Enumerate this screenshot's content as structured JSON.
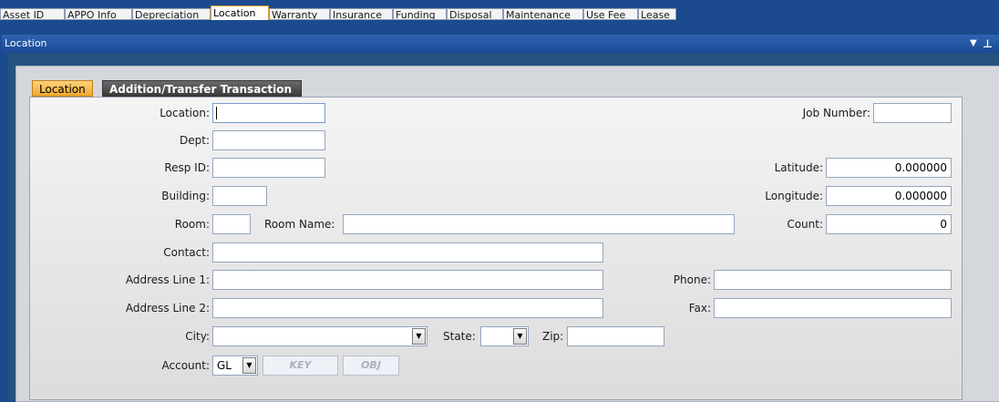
{
  "top_tabs": [
    {
      "label": "Asset ID"
    },
    {
      "label": "APPO Info"
    },
    {
      "label": "Depreciation"
    },
    {
      "label": "Location",
      "active": true
    },
    {
      "label": "Warranty"
    },
    {
      "label": "Insurance"
    },
    {
      "label": "Funding"
    },
    {
      "label": "Disposal"
    },
    {
      "label": "Maintenance"
    },
    {
      "label": "Use Fee"
    },
    {
      "label": "Lease"
    }
  ],
  "panel": {
    "title": "Location",
    "menu_icon": "dropdown-arrow-icon",
    "pin_icon": "pin-icon"
  },
  "inner_tabs": [
    {
      "label": "Location",
      "active": true
    },
    {
      "label": "Addition/Transfer Transaction"
    }
  ],
  "form": {
    "location": {
      "label": "Location:",
      "value": ""
    },
    "dept": {
      "label": "Dept:",
      "value": ""
    },
    "resp_id": {
      "label": "Resp ID:",
      "value": ""
    },
    "building": {
      "label": "Building:",
      "value": ""
    },
    "room": {
      "label": "Room:",
      "value": ""
    },
    "room_name": {
      "label": "Room Name:",
      "value": ""
    },
    "contact": {
      "label": "Contact:",
      "value": ""
    },
    "address1": {
      "label": "Address Line 1:",
      "value": ""
    },
    "address2": {
      "label": "Address Line 2:",
      "value": ""
    },
    "city": {
      "label": "City:",
      "value": ""
    },
    "state": {
      "label": "State:",
      "value": ""
    },
    "zip": {
      "label": "Zip:",
      "value": ""
    },
    "account": {
      "label": "Account:",
      "value": "GL",
      "key_placeholder": "KEY",
      "obj_placeholder": "OBJ"
    },
    "job_number": {
      "label": "Job Number:",
      "value": ""
    },
    "latitude": {
      "label": "Latitude:",
      "value": "0.000000"
    },
    "longitude": {
      "label": "Longitude:",
      "value": "0.000000"
    },
    "count": {
      "label": "Count:",
      "value": "0"
    },
    "phone": {
      "label": "Phone:",
      "value": ""
    },
    "fax": {
      "label": "Fax:",
      "value": ""
    }
  },
  "colors": {
    "header_blue": "#1b4a8e",
    "active_tab_orange": "#f0a92e",
    "field_border": "#95a5bf"
  }
}
